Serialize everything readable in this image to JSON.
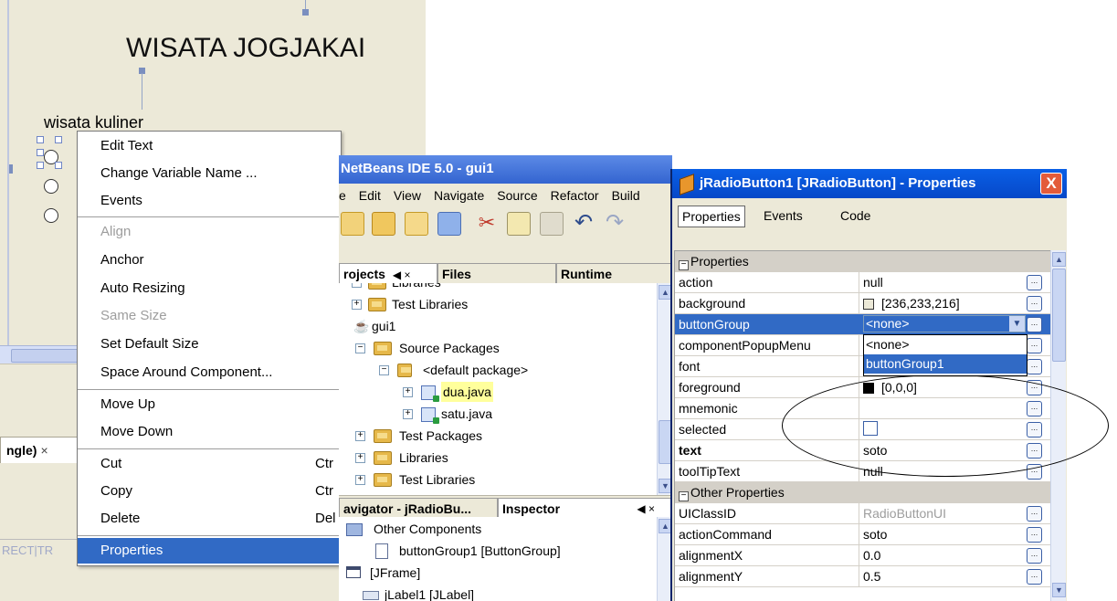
{
  "designer": {
    "title": "WISATA JOGJAKAI",
    "label": "wisata kuliner",
    "tab_label": "ngle)",
    "tab_close": "×",
    "status_text": "RECT|TR"
  },
  "context_menu": {
    "items": [
      {
        "label": "Edit Text",
        "shortcut": ""
      },
      {
        "label": "Change Variable Name ...",
        "shortcut": ""
      },
      {
        "label": "Events",
        "shortcut": ""
      },
      {
        "label": "Align",
        "shortcut": ""
      },
      {
        "label": "Anchor",
        "shortcut": ""
      },
      {
        "label": "Auto Resizing",
        "shortcut": ""
      },
      {
        "label": "Same Size",
        "shortcut": ""
      },
      {
        "label": "Set Default Size",
        "shortcut": ""
      },
      {
        "label": "Space Around Component...",
        "shortcut": ""
      },
      {
        "label": "Move Up",
        "shortcut": ""
      },
      {
        "label": "Move Down",
        "shortcut": ""
      },
      {
        "label": "Cut",
        "shortcut": "Ctr"
      },
      {
        "label": "Copy",
        "shortcut": "Ctr"
      },
      {
        "label": "Delete",
        "shortcut": "Del"
      },
      {
        "label": "Properties",
        "shortcut": ""
      }
    ]
  },
  "ide": {
    "title": "NetBeans IDE 5.0 - gui1",
    "menu": [
      "e",
      "Edit",
      "View",
      "Navigate",
      "Source",
      "Refactor",
      "Build"
    ],
    "tabs": {
      "projects": "rojects",
      "projects_controls": "◀ ×",
      "files": "Files",
      "runtime": "Runtime"
    },
    "project_tree": {
      "libraries_cut": "Libraries",
      "test_libraries": "Test Libraries",
      "gui1": "gui1",
      "source_packages": "Source Packages",
      "default_package": "<default package>",
      "dua": "dua.java",
      "satu": "satu.java",
      "test_packages": "Test Packages",
      "libraries": "Libraries",
      "test_libraries_2": "Test Libraries"
    },
    "bottom_tabs": {
      "navigator": "avigator - jRadioBu...",
      "inspector": "Inspector",
      "inspector_controls": "◀ ×"
    },
    "inspector_tree": {
      "other_components": "Other Components",
      "button_group": "buttonGroup1 [ButtonGroup]",
      "jframe": "[JFrame]",
      "jlabel": "jLabel1 [JLabel]"
    }
  },
  "properties": {
    "title": "jRadioButton1 [JRadioButton] - Properties",
    "close": "X",
    "tabs": [
      "Properties",
      "Events",
      "Code"
    ],
    "category_properties": "Properties",
    "category_other": "Other Properties",
    "combo_value": "<none>",
    "dropdown_options": [
      "<none>",
      "buttonGroup1"
    ],
    "rows": [
      {
        "name": "action",
        "value": "null"
      },
      {
        "name": "background",
        "value": "[236,233,216]"
      },
      {
        "name": "buttonGroup",
        "value": ""
      },
      {
        "name": "componentPopupMenu",
        "value": ""
      },
      {
        "name": "font",
        "value": ""
      },
      {
        "name": "foreground",
        "value": "[0,0,0]"
      },
      {
        "name": "mnemonic",
        "value": ""
      },
      {
        "name": "selected",
        "value": ""
      },
      {
        "name": "text",
        "value": "soto"
      },
      {
        "name": "toolTipText",
        "value": "null"
      }
    ],
    "other_rows": [
      {
        "name": "UIClassID",
        "value": "RadioButtonUI"
      },
      {
        "name": "actionCommand",
        "value": "soto"
      },
      {
        "name": "alignmentX",
        "value": "0.0"
      },
      {
        "name": "alignmentY",
        "value": "0.5"
      }
    ],
    "background_swatch": "#ece9d8",
    "foreground_swatch": "#000000",
    "ellipsis": "..."
  },
  "colors": {
    "selection": "#316ac5",
    "title_blue": "#0a5fe6",
    "menu_bar": "#ece9d8"
  }
}
